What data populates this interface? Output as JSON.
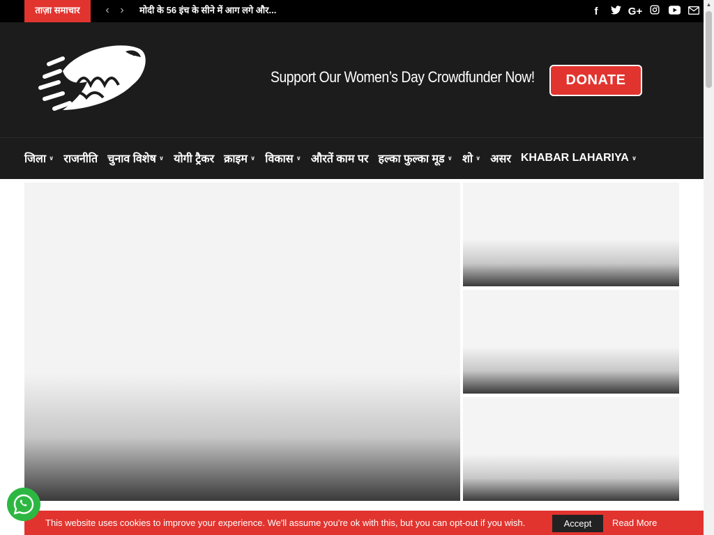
{
  "topbar": {
    "breaking_label": "ताज़ा समाचार",
    "ticker_headline": "मोदी के 56 इंच के सीने में आग लगे और...",
    "social_icons": [
      "facebook-icon",
      "twitter-icon",
      "google-plus-icon",
      "instagram-icon",
      "youtube-icon",
      "email-icon"
    ]
  },
  "header": {
    "logo_alt": "खबर लहरिया",
    "promo_text": "Support Our Women’s Day Crowdfunder Now!",
    "donate_label": "DONATE"
  },
  "nav": {
    "items": [
      {
        "label": "जिला",
        "has_dropdown": true
      },
      {
        "label": "राजनीति",
        "has_dropdown": false
      },
      {
        "label": "चुनाव विशेष",
        "has_dropdown": true
      },
      {
        "label": "योगी ट्रैकर",
        "has_dropdown": false
      },
      {
        "label": "क्राइम",
        "has_dropdown": true
      },
      {
        "label": "विकास",
        "has_dropdown": true
      },
      {
        "label": "औरतें काम पर",
        "has_dropdown": false
      },
      {
        "label": "हल्का फुल्का मूड",
        "has_dropdown": true
      },
      {
        "label": "शो",
        "has_dropdown": true
      },
      {
        "label": "असर",
        "has_dropdown": false
      },
      {
        "label": "KHABAR LAHARIYA",
        "has_dropdown": true
      }
    ]
  },
  "cookie": {
    "message": "This website uses cookies to improve your experience. We'll assume you're ok with this, but you can opt-out if you wish.",
    "accept_label": "Accept",
    "read_more_label": "Read More"
  },
  "colors": {
    "accent": "#e2342f",
    "header_bg": "#1c1c1c",
    "topbar_bg": "#000000",
    "whatsapp": "#2db742"
  }
}
